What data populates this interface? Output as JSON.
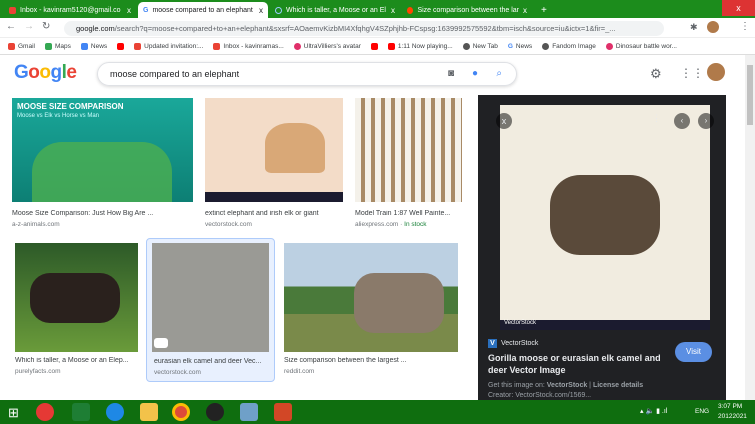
{
  "tabs": [
    {
      "label": "Inbox - kavinram5120@gmail.co",
      "active": false
    },
    {
      "label": "moose compared to an elephant",
      "active": true
    },
    {
      "label": "Which is taller, a Moose or an El",
      "active": false
    },
    {
      "label": "Size comparison between the lar",
      "active": false
    }
  ],
  "new_tab": "+",
  "close": "x",
  "url_host": "google.com",
  "url_path": "/search?q=moose+compared+to+an+elephant&sxsrf=AOaemvKizbMI4XfqhgV4SZphjhb-FCspsg:1639992575592&tbm=isch&source=iu&ictx=1&fir=_...",
  "bookmarks": [
    "Gmail",
    "Maps",
    "News",
    "Updated invitation:...",
    "Inbox - kavinramas...",
    "UltraVilliers's avatar",
    "1:11 Now playing...",
    "New Tab",
    "News",
    "Fandom Image",
    "Dinosaur battle wor..."
  ],
  "logo": "Google",
  "query": "moose compared to an elephant",
  "results": [
    {
      "title": "Moose Size Comparison: Just How Big Are ...",
      "source": "a-z-animals.com",
      "overlay_title": "MOOSE SIZE COMPARISON",
      "overlay_sub": "Moose vs Elk vs Horse vs Man"
    },
    {
      "title": "extinct elephant and irish elk or giant",
      "source": "vectorstock.com"
    },
    {
      "title": "Model Train 1:87 Well Painte...",
      "source": "aliexpress.com",
      "stock": "In stock"
    },
    {
      "title": "Which is taller, a Moose or an Elep...",
      "source": "purelyfacts.com"
    },
    {
      "title": "eurasian elk camel and deer Vec...",
      "source": "vectorstock.com"
    },
    {
      "title": "Size comparison between the largest ...",
      "source": "reddit.com"
    }
  ],
  "panel": {
    "site": "VectorStock",
    "title": "Gorilla moose or eurasian elk camel and deer Vector Image",
    "visit": "Visit",
    "get_label": "Get this image on:",
    "get_site": "VectorStock",
    "license": "License details",
    "creator": "Creator: VectorStock.com/1569...",
    "watermark": "VectorStock"
  },
  "tray": {
    "lang": "ENG",
    "time": "3:07 PM",
    "date": "20122021"
  }
}
